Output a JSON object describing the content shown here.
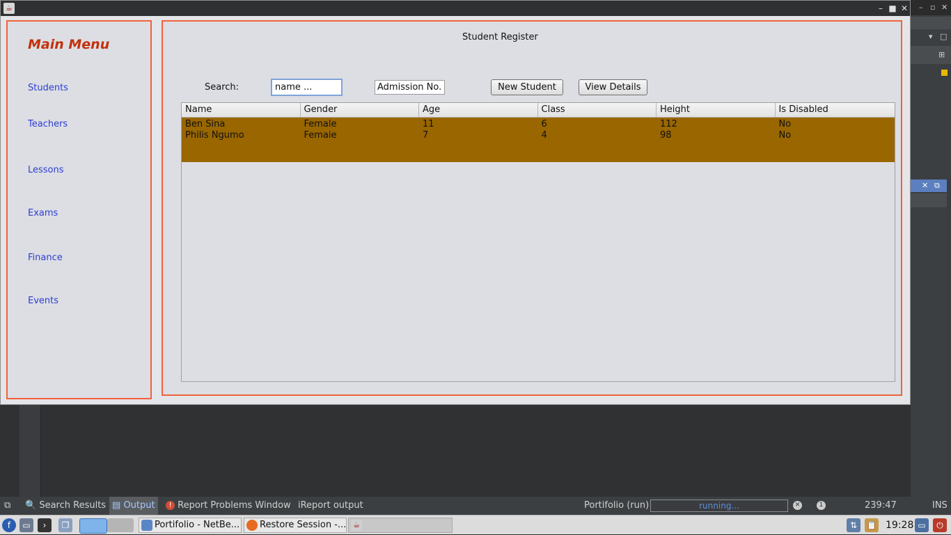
{
  "app": {
    "main_menu_title": "Main Menu",
    "nav": [
      "Students",
      "Teachers",
      "Lessons",
      "Exams",
      "Finance",
      "Events"
    ],
    "page_title": "Student Register",
    "search_label": "Search:",
    "search_value": "name ...",
    "admission_value": "Admission No.",
    "new_student_label": "New Student",
    "view_details_label": "View Details",
    "table": {
      "columns": [
        "Name",
        "Gender",
        "Age",
        "Class",
        "Height",
        "Is Disabled"
      ],
      "rows": [
        [
          "Ben Sina",
          "Female",
          "11",
          "6",
          "112",
          "No"
        ],
        [
          "Philis Ngumo",
          "Femaie",
          "7",
          "4",
          "98",
          "No"
        ]
      ]
    }
  },
  "ide_status": {
    "search_results": "Search Results",
    "output": "Output",
    "report_problems": "Report Problems Window",
    "ireport_output": "iReport output",
    "run_label": "Portifolio (run)",
    "progress_text": "running...",
    "cursor_position": "239:47",
    "insert_mode": "INS"
  },
  "taskbar": {
    "windows": [
      "Portifolio - NetBe...",
      "Restore Session -...",
      ""
    ],
    "clock": "19:28"
  },
  "colors": {
    "panel_border": "#f0623a",
    "menu_title": "#c2310b",
    "nav_link": "#2e3dd0",
    "row_selected": "#996600"
  }
}
